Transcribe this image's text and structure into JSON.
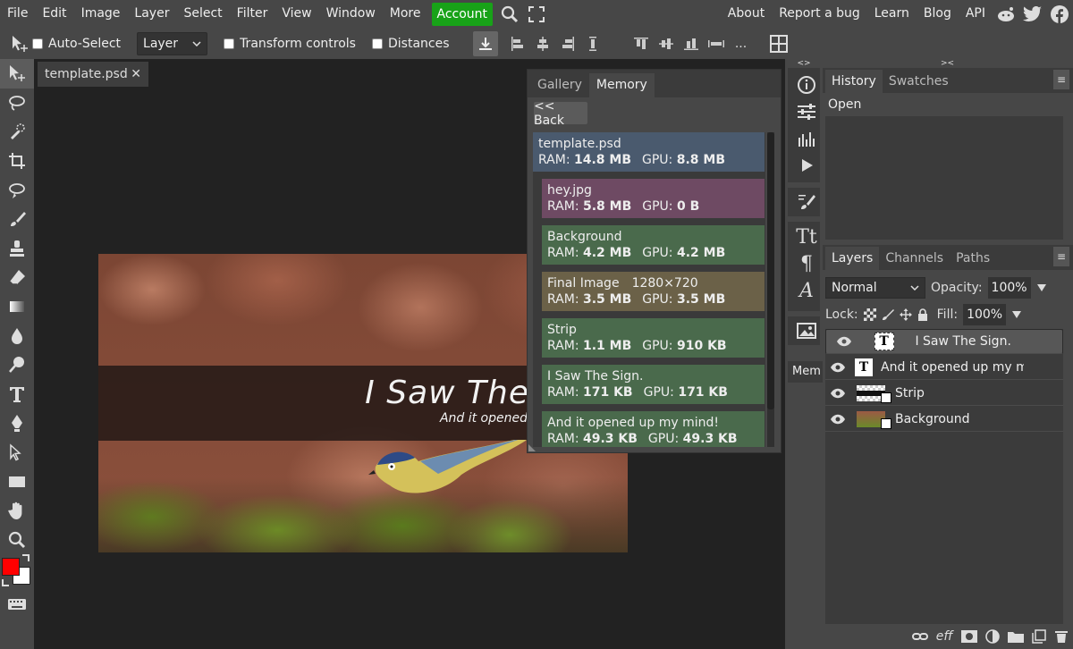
{
  "menu": {
    "items": [
      "File",
      "Edit",
      "Image",
      "Layer",
      "Select",
      "Filter",
      "View",
      "Window",
      "More"
    ],
    "account": "Account",
    "right": [
      "About",
      "Report a bug",
      "Learn",
      "Blog",
      "API"
    ]
  },
  "options": {
    "auto_select": "Auto-Select",
    "layer_select": "Layer",
    "transform_controls": "Transform controls",
    "distances": "Distances",
    "more": "..."
  },
  "document": {
    "tab_name": "template.psd",
    "close": "✕",
    "canvas_title": "I Saw The",
    "canvas_subtitle": "And it opened"
  },
  "memory_window": {
    "tabs": [
      "Gallery",
      "Memory"
    ],
    "back_label": "<< Back",
    "items": [
      {
        "name": "template.psd",
        "extra": "",
        "ram": "14.8 MB",
        "gpu": "8.8 MB",
        "color": "#4a5a6e"
      },
      {
        "name": "hey.jpg",
        "extra": "",
        "ram": "5.8 MB",
        "gpu": "0 B",
        "color": "#6e4a63"
      },
      {
        "name": "Background",
        "extra": "",
        "ram": "4.2 MB",
        "gpu": "4.2 MB",
        "color": "#4a6a4c"
      },
      {
        "name": "Final Image",
        "extra": "1280×720",
        "ram": "3.5 MB",
        "gpu": "3.5 MB",
        "color": "#6b6148"
      },
      {
        "name": "Strip",
        "extra": "",
        "ram": "1.1 MB",
        "gpu": "910 KB",
        "color": "#4a6a4c"
      },
      {
        "name": "I Saw The Sign.",
        "extra": "",
        "ram": "171 KB",
        "gpu": "171 KB",
        "color": "#4a6a4c"
      },
      {
        "name": "And it opened up my mind!",
        "extra": "",
        "ram": "49.3 KB",
        "gpu": "49.3 KB",
        "color": "#4a6a4c"
      }
    ],
    "ram_label": "RAM: ",
    "gpu_label": "GPU: "
  },
  "right_strip": {
    "mem_short": "Mem",
    "arrows_left": "<>",
    "arrows_right": "><"
  },
  "history_panel": {
    "tabs": [
      "History",
      "Swatches"
    ],
    "items": [
      "Open"
    ]
  },
  "layers_panel": {
    "tabs": [
      "Layers",
      "Channels",
      "Paths"
    ],
    "blend_mode": "Normal",
    "opacity_label": "Opacity:",
    "opacity_value": "100%",
    "lock_label": "Lock:",
    "fill_label": "Fill:",
    "fill_value": "100%",
    "layers": [
      {
        "name": "I Saw The Sign.",
        "type": "text"
      },
      {
        "name": "And it opened up my mind!",
        "type": "text"
      },
      {
        "name": "Strip",
        "type": "strip"
      },
      {
        "name": "Background",
        "type": "image"
      }
    ]
  },
  "colors": {
    "foreground": "#ff0000",
    "background": "#ffffff",
    "accent": "#18a218"
  }
}
